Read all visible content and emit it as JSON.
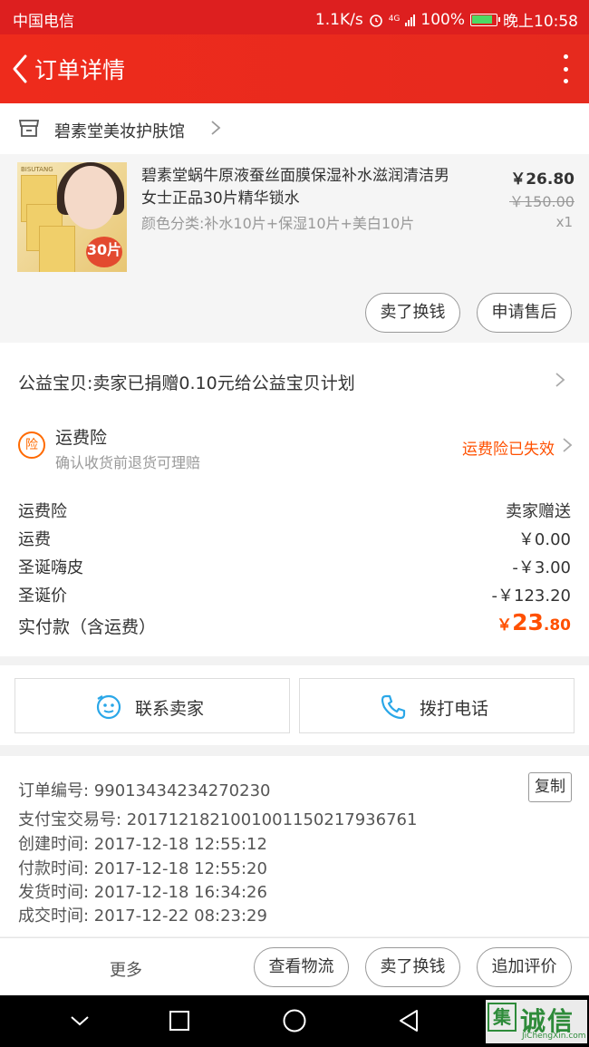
{
  "status_bar": {
    "carrier": "中国电信",
    "speed": "1.1K/s",
    "network": "4G",
    "battery": "100%",
    "time": "晚上10:58"
  },
  "nav": {
    "title": "订单详情"
  },
  "shop": {
    "name": "碧素堂美妆护肤馆"
  },
  "product": {
    "title": "碧素堂蜗牛原液蚕丝面膜保湿补水滋润清洁男女士正品30片精华锁水",
    "spec": "颜色分类:补水10片+保湿10片+美白10片",
    "price": "￥26.80",
    "original_price": "￥150.00",
    "quantity": "x1",
    "image_brand": "BISUTANG",
    "image_badge": "30片",
    "buttons": {
      "sell": "卖了换钱",
      "after_sale": "申请售后"
    }
  },
  "charity": {
    "text": "公益宝贝:卖家已捐赠0.10元给公益宝贝计划"
  },
  "insurance": {
    "icon_text": "险",
    "title": "运费险",
    "subtitle": "确认收货前退货可理赔",
    "status": "运费险已失效"
  },
  "fees": [
    {
      "label": "运费险",
      "value": "卖家赠送"
    },
    {
      "label": "运费",
      "value": "￥0.00"
    },
    {
      "label": "圣诞嗨皮",
      "value": "-￥3.00"
    },
    {
      "label": "圣诞价",
      "value": "-￥123.20"
    }
  ],
  "total": {
    "label": "实付款（含运费）",
    "currency": "￥",
    "integer": "23",
    "decimal": ".80"
  },
  "contact": {
    "seller": "联系卖家",
    "phone": "拨打电话"
  },
  "order_info": {
    "copy_label": "复制",
    "lines": [
      "订单编号: 99013434234270230",
      "支付宝交易号: 2017121821001001150217936761",
      "创建时间: 2017-12-18 12:55:12",
      "付款时间: 2017-12-18 12:55:20",
      "发货时间: 2017-12-18 16:34:26",
      "成交时间: 2017-12-22 08:23:29"
    ]
  },
  "bottom_bar": {
    "more": "更多",
    "logistics": "查看物流",
    "sell": "卖了换钱",
    "review": "追加评价"
  },
  "watermark": {
    "logo": "集",
    "cn": "诚信",
    "en": "JiChengXin.com"
  },
  "colors": {
    "nav_red": "#e62a1e",
    "accent_orange": "#ff5000",
    "contact_blue": "#2aa7e8"
  }
}
